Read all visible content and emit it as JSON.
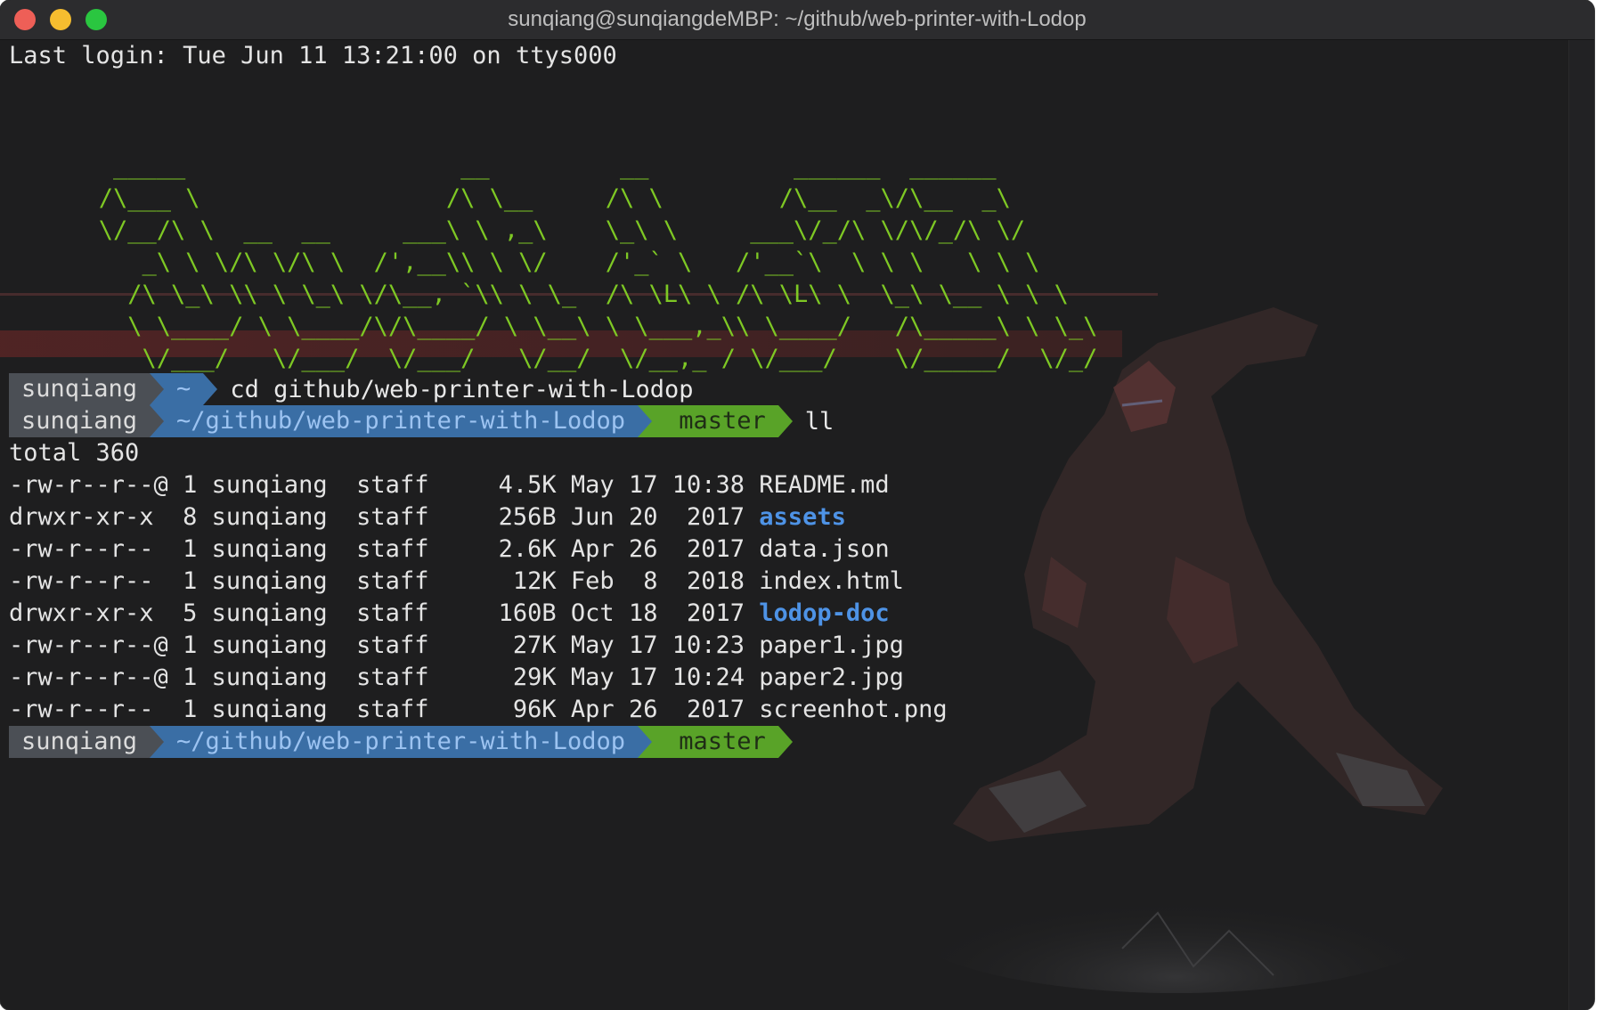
{
  "window": {
    "title": "sunqiang@sunqiangdeMBP: ~/github/web-printer-with-Lodop"
  },
  "terminal": {
    "last_login": "Last login: Tue Jun 11 13:21:00 on ttys000",
    "ascii_art": [
      "    _____                   __         __          ______  ______",
      "   /\\___ \\                 /\\ \\__     /\\ \\        /\\__  _\\/\\__  _\\",
      "   \\/__/\\ \\  __  __     ___\\ \\ ,_\\    \\_\\ \\     ___\\/_/\\ \\/\\/_/\\ \\/",
      "      _\\ \\ \\/\\ \\/\\ \\  /',__\\\\ \\ \\/    /'_` \\   /'__`\\  \\ \\ \\   \\ \\ \\",
      "     /\\ \\_\\ \\\\ \\ \\_\\ \\/\\__, `\\\\ \\ \\_  /\\ \\L\\ \\ /\\ \\L\\ \\  \\_\\ \\__ \\ \\ \\",
      "     \\ \\____/ \\ \\____/\\/\\____/ \\ \\__\\ \\ \\___,_\\\\ \\____/   /\\_____\\ \\ \\_\\",
      "      \\/___/   \\/___/  \\/___/   \\/__/  \\/__,_ / \\/___/    \\/_____/  \\/_/"
    ],
    "prompt1": {
      "user": "sunqiang",
      "path": "~",
      "command": "cd github/web-printer-with-Lodop"
    },
    "prompt2": {
      "user": "sunqiang",
      "path": "~/github/web-printer-with-Lodop",
      "branch_icon": "",
      "branch": "master",
      "command": "ll"
    },
    "total": "total 360",
    "listing": [
      {
        "perms": "-rw-r--r--@",
        "links": "1",
        "owner": "sunqiang",
        "group": "staff",
        "size": "4.5K",
        "month": "May",
        "day": "17",
        "time": "10:38",
        "name": "README.md",
        "is_dir": false
      },
      {
        "perms": "drwxr-xr-x ",
        "links": "8",
        "owner": "sunqiang",
        "group": "staff",
        "size": "256B",
        "month": "Jun",
        "day": "20",
        "time": " 2017",
        "name": "assets",
        "is_dir": true
      },
      {
        "perms": "-rw-r--r-- ",
        "links": "1",
        "owner": "sunqiang",
        "group": "staff",
        "size": "2.6K",
        "month": "Apr",
        "day": "26",
        "time": " 2017",
        "name": "data.json",
        "is_dir": false
      },
      {
        "perms": "-rw-r--r-- ",
        "links": "1",
        "owner": "sunqiang",
        "group": "staff",
        "size": " 12K",
        "month": "Feb",
        "day": " 8",
        "time": " 2018",
        "name": "index.html",
        "is_dir": false
      },
      {
        "perms": "drwxr-xr-x ",
        "links": "5",
        "owner": "sunqiang",
        "group": "staff",
        "size": "160B",
        "month": "Oct",
        "day": "18",
        "time": " 2017",
        "name": "lodop-doc",
        "is_dir": true
      },
      {
        "perms": "-rw-r--r--@",
        "links": "1",
        "owner": "sunqiang",
        "group": "staff",
        "size": " 27K",
        "month": "May",
        "day": "17",
        "time": "10:23",
        "name": "paper1.jpg",
        "is_dir": false
      },
      {
        "perms": "-rw-r--r--@",
        "links": "1",
        "owner": "sunqiang",
        "group": "staff",
        "size": " 29K",
        "month": "May",
        "day": "17",
        "time": "10:24",
        "name": "paper2.jpg",
        "is_dir": false
      },
      {
        "perms": "-rw-r--r-- ",
        "links": "1",
        "owner": "sunqiang",
        "group": "staff",
        "size": " 96K",
        "month": "Apr",
        "day": "26",
        "time": " 2017",
        "name": "screenhot.png",
        "is_dir": false
      }
    ],
    "prompt3": {
      "user": "sunqiang",
      "path": "~/github/web-printer-with-Lodop",
      "branch_icon": "",
      "branch": "master"
    }
  },
  "colors": {
    "ascii_green": "#7ec824",
    "directory_blue": "#4e93e6",
    "prompt_user_bg": "#4b4f55",
    "prompt_path_bg": "#3a6ea5",
    "prompt_git_bg": "#59a328"
  },
  "icons": {
    "background_figure": "iron-man-silhouette-icon",
    "branch": "git-branch-icon"
  }
}
